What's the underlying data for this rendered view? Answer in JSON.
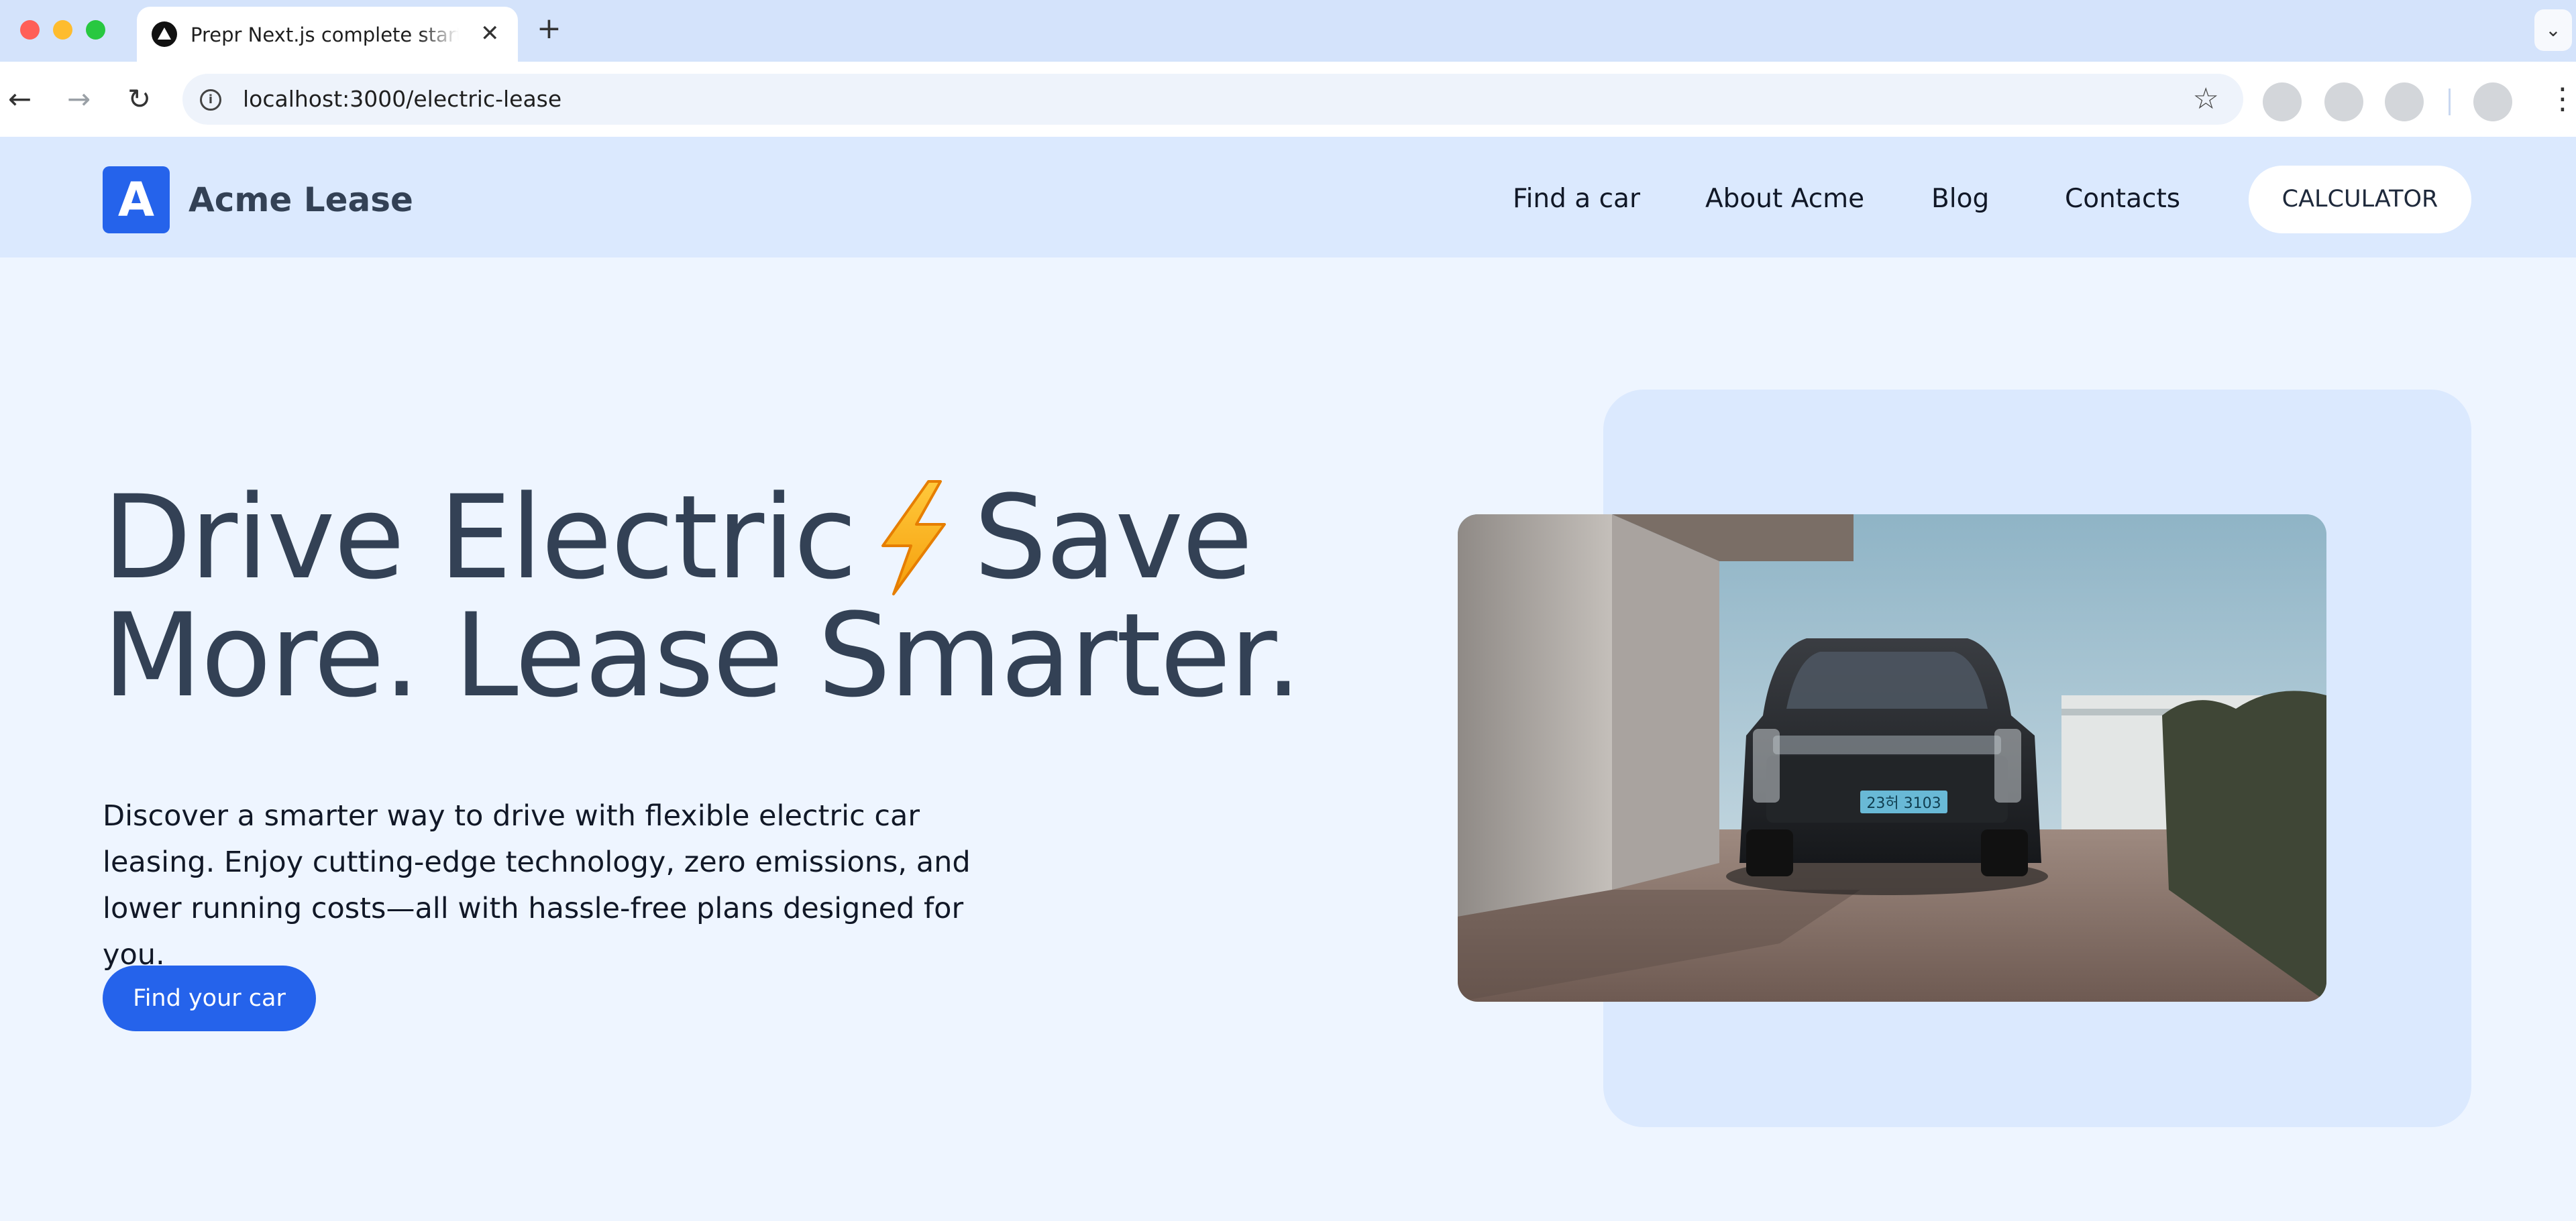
{
  "browser": {
    "tab_title": "Prepr Next.js complete starter",
    "url": "localhost:3000/electric-lease",
    "icons": {
      "favicon": "vercel-triangle-icon",
      "close": "close-icon",
      "new_tab": "plus-icon",
      "tab_menu": "chevron-down-icon",
      "back": "arrow-left-icon",
      "forward": "arrow-right-icon",
      "reload": "reload-icon",
      "site_info": "info-icon",
      "bookmark": "star-icon",
      "menu": "kebab-menu-icon"
    }
  },
  "header": {
    "logo_letter": "A",
    "brand": "Acme Lease",
    "nav": {
      "find": "Find a car",
      "about": "About Acme",
      "blog": "Blog",
      "contacts": "Contacts"
    },
    "cta": "CALCULATOR"
  },
  "hero": {
    "title_part1": "Drive Electric",
    "title_emoji": "⚡",
    "title_part2": "Save More. Lease Smarter.",
    "description": "Discover a smarter way to drive with flexible electric car leasing. Enjoy cutting-edge technology, zero emissions, and lower running costs—all with hassle-free plans designed for you.",
    "cta": "Find your car",
    "image_plate": "23허 3103"
  },
  "colors": {
    "accent": "#2563eb",
    "header_bg": "#dbe9fe",
    "page_bg": "#eef5ff",
    "heading": "#334155"
  }
}
